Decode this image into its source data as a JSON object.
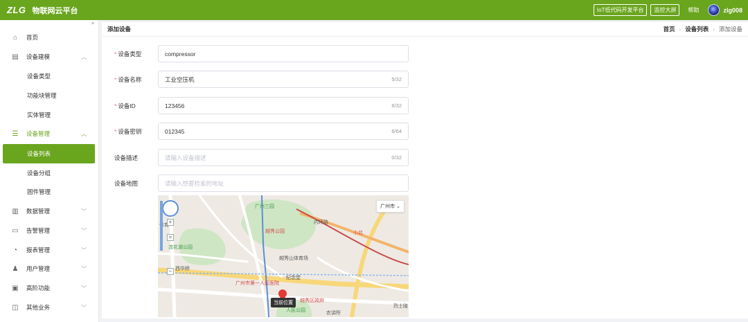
{
  "header": {
    "logo": "ZLG",
    "title": "物联网云平台",
    "iot_button": "IoT低代码开发平台",
    "monitor_button": "监控大屏",
    "help": "帮助",
    "username": "zlg008"
  },
  "sidebar": {
    "items": [
      {
        "label": "首页"
      },
      {
        "label": "设备建模"
      },
      {
        "label": "设备类型"
      },
      {
        "label": "功能块管理"
      },
      {
        "label": "实体管理"
      },
      {
        "label": "设备管理"
      },
      {
        "label": "设备列表"
      },
      {
        "label": "设备分组"
      },
      {
        "label": "固件管理"
      },
      {
        "label": "数据管理"
      },
      {
        "label": "告警管理"
      },
      {
        "label": "报表管理"
      },
      {
        "label": "用户管理"
      },
      {
        "label": "高阶功能"
      },
      {
        "label": "其他业务"
      }
    ]
  },
  "page": {
    "title": "添加设备",
    "breadcrumb": [
      "首页",
      "设备列表",
      "添加设备"
    ]
  },
  "form": {
    "device_type": {
      "label": "设备类型",
      "value": "compressor"
    },
    "device_name": {
      "label": "设备名称",
      "value": "工业空压机",
      "count": "5/32"
    },
    "device_id": {
      "label": "设备ID",
      "value": "123456",
      "count": "6/32"
    },
    "device_secret": {
      "label": "设备密钥",
      "value": "012345",
      "count": "6/64"
    },
    "device_desc": {
      "label": "设备描述",
      "placeholder": "请输入设备描述",
      "count": "0/32"
    },
    "device_location": {
      "label": "设备地图",
      "placeholder": "请输入想要检索的地址"
    }
  },
  "map": {
    "city": "广州市",
    "labels": {
      "sanyuan": "广州三园",
      "ring_road": "内环路",
      "yuexiu_park": "越秀公园",
      "xiaobei": "小北",
      "liuhua_park": "流花湖公园",
      "stadium": "越秀山体育场",
      "xihua": "西华桥",
      "memorial": "纪念堂",
      "hospital": "广州市第一人民医院",
      "district_gov": "越秀区政府",
      "peoples_park": "人民公园",
      "nonglusuo": "农讲所",
      "lieshi": "烈士陵",
      "tiyu": "体育",
      "current_location": "当前位置"
    }
  },
  "colors": {
    "brand": "#6aa51e"
  }
}
